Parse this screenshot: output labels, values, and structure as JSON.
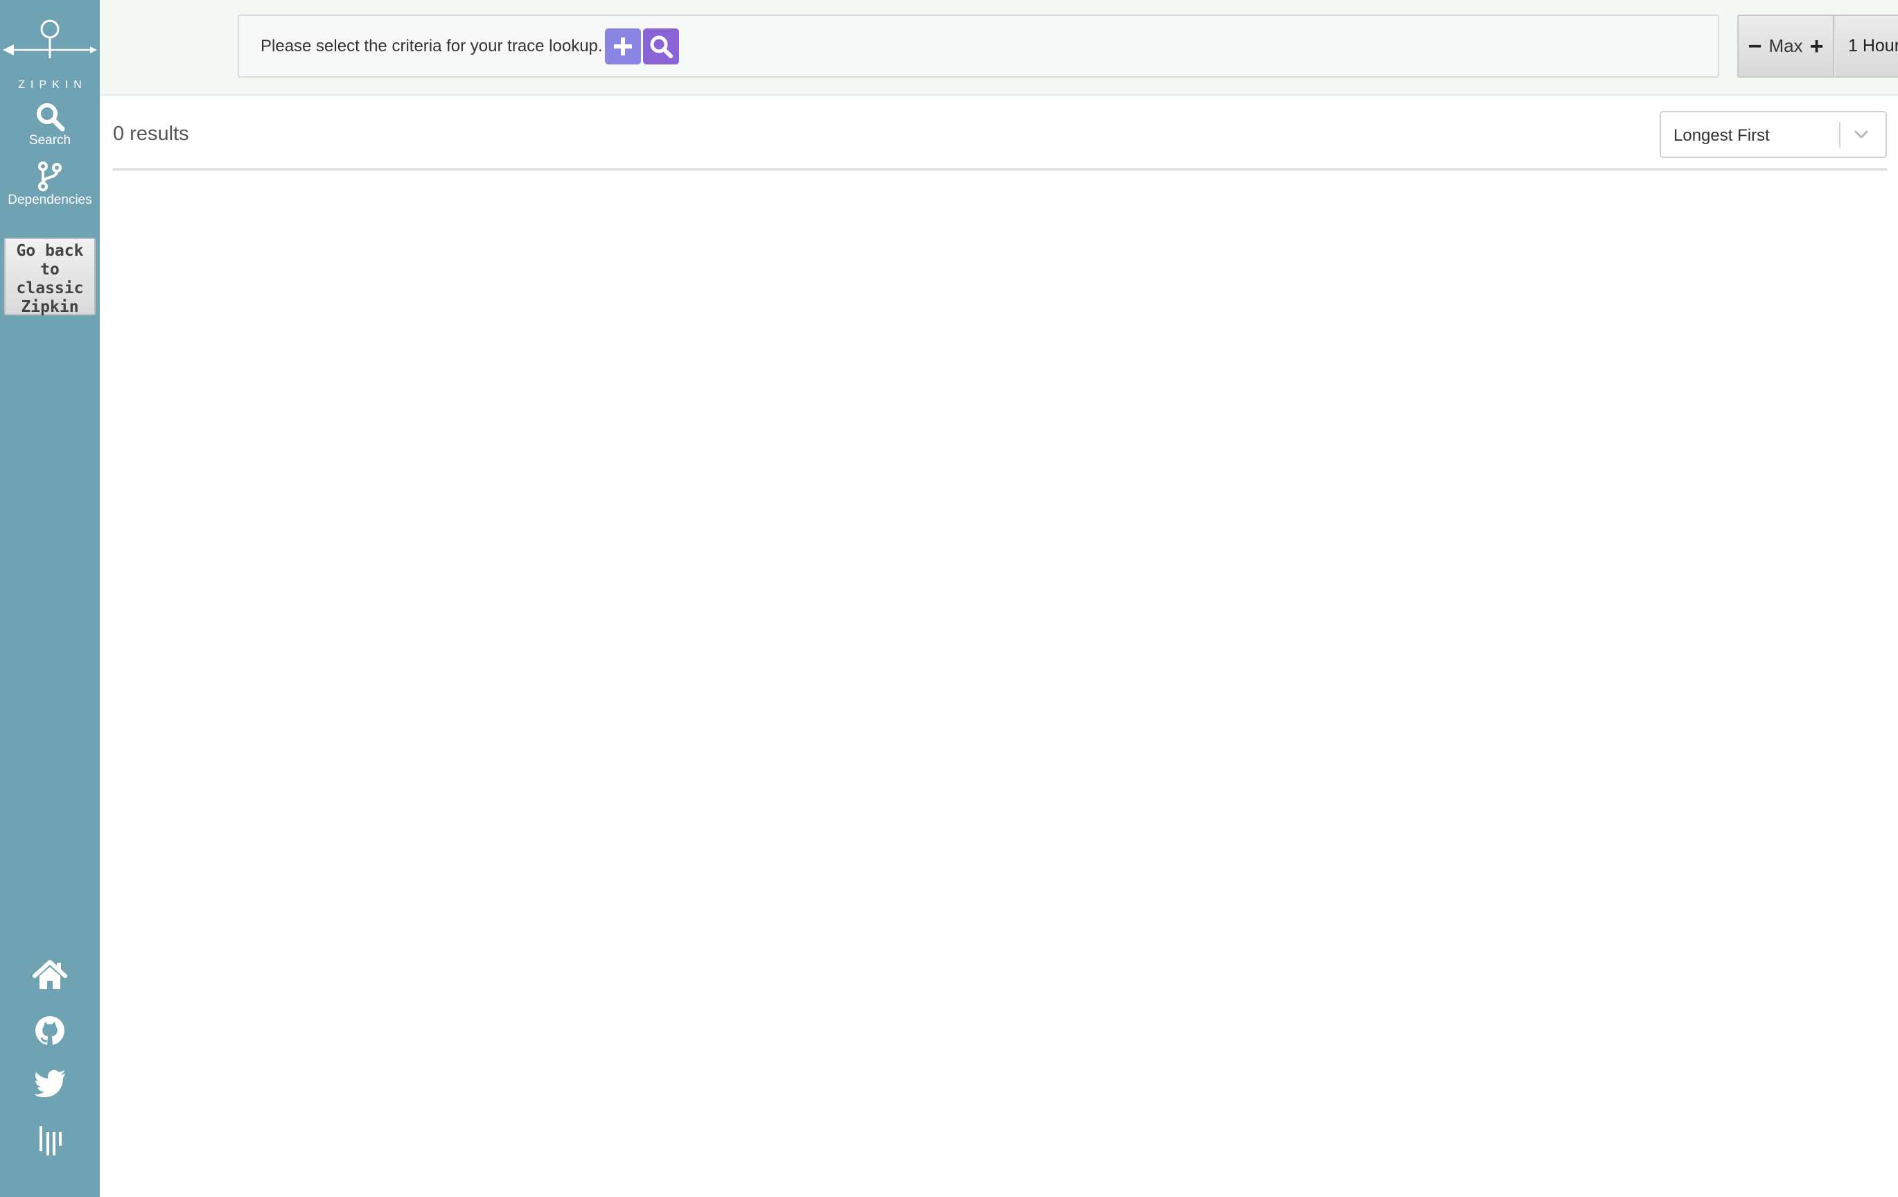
{
  "brand": {
    "logo_text": "ZIPKIN"
  },
  "sidebar": {
    "nav": [
      {
        "label": "Search",
        "icon": "search-icon"
      },
      {
        "label": "Dependencies",
        "icon": "branch-icon"
      }
    ],
    "classic_button_label": "Go back\nto\nclassic\nZipkin",
    "bottom_icons": [
      "home-icon",
      "github-icon",
      "twitter-icon",
      "gitter-icon"
    ]
  },
  "header": {
    "criteria_prompt": "Please select the criteria for your trace lookup.",
    "limit_label": "Max",
    "lookback_label": "1 Hour"
  },
  "results": {
    "count_label": "0 results",
    "sort_selected": "Longest First"
  },
  "colors": {
    "sidebar": "#6fa3b3",
    "add_button": "#8a84e2",
    "search_button": "#8a64d6",
    "header_band": "#f4f8f5"
  }
}
